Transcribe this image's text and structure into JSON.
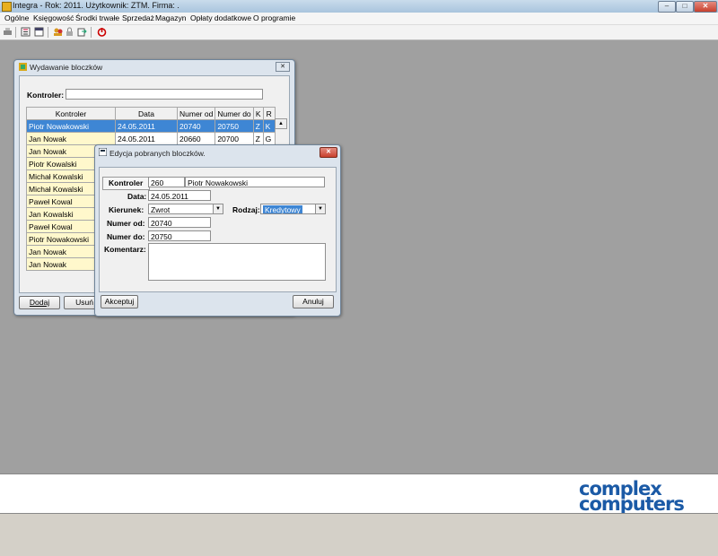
{
  "titlebar": {
    "title": "Integra -  Rok: 2011. Użytkownik: ZTM. Firma: ."
  },
  "menu": [
    "Ogólne",
    "Księgowość",
    "Środki trwałe",
    "Sprzedaż",
    "Magazyn",
    "Opłaty dodatkowe",
    "O programie"
  ],
  "toolbar_icons": [
    "printer-icon",
    "list-icon",
    "calendar-icon",
    "users-icon",
    "lock-icon",
    "export-icon",
    "power-icon"
  ],
  "colors": {
    "workspace": "#a0a0a0",
    "selection": "#3e86d4",
    "kontroler_cell": "#fff8cc",
    "logo": "#1b5aa6"
  },
  "wydawanie": {
    "title": "Wydawanie bloczków",
    "kontroler_label": "Kontroler:",
    "kontroler_value": "",
    "columns": [
      "Kontroler",
      "Data",
      "Numer od",
      "Numer do",
      "K",
      "R"
    ],
    "rows": [
      {
        "kontroler": "Piotr Nowakowski",
        "data": "24.05.2011",
        "od": "20740",
        "do": "20750",
        "k": "Z",
        "r": "K"
      },
      {
        "kontroler": "Jan Nowak",
        "data": "24.05.2011",
        "od": "20660",
        "do": "20700",
        "k": "Z",
        "r": "G"
      },
      {
        "kontroler": "Jan Nowak"
      },
      {
        "kontroler": "Piotr Kowalski"
      },
      {
        "kontroler": "Michał Kowalski"
      },
      {
        "kontroler": "Michał Kowalski"
      },
      {
        "kontroler": "Paweł Kowal"
      },
      {
        "kontroler": "Jan Kowalski"
      },
      {
        "kontroler": "Paweł Kowal"
      },
      {
        "kontroler": "Piotr Nowakowski"
      },
      {
        "kontroler": "Jan Nowak"
      },
      {
        "kontroler": "Jan Nowak"
      }
    ],
    "dodaj": "Dodaj",
    "usun": "Usuń"
  },
  "edycja": {
    "title": "Edycja pobranych bloczków.",
    "kontroler_label": "Kontroler",
    "kontroler_id": "260",
    "kontroler_name": "Piotr Nowakowski",
    "data_label": "Data:",
    "data_value": "24.05.2011",
    "kierunek_label": "Kierunek:",
    "kierunek_value": "Zwrot",
    "rodzaj_label": "Rodzaj:",
    "rodzaj_value": "Kredytowy",
    "numer_od_label": "Numer od:",
    "numer_od_value": "20740",
    "numer_do_label": "Numer do:",
    "numer_do_value": "20750",
    "komentarz_label": "Komentarz:",
    "komentarz_value": "",
    "akceptuj": "Akceptuj",
    "anuluj": "Anuluj"
  },
  "logo": {
    "line1": "complex",
    "line2": "computers"
  }
}
